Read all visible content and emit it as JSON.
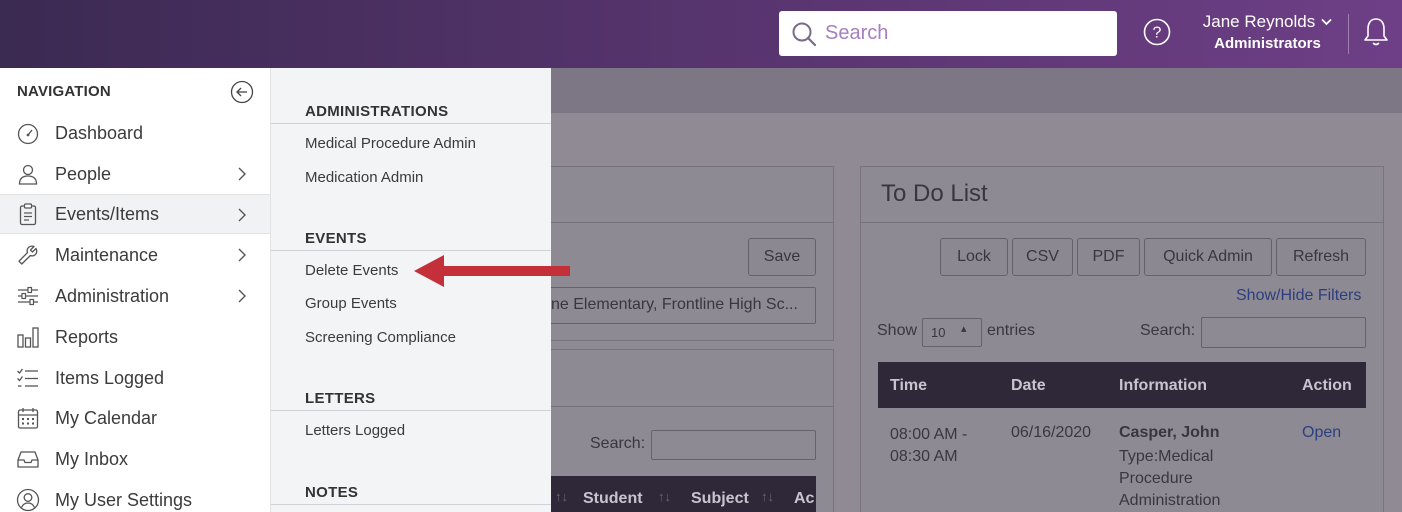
{
  "header": {
    "search_placeholder": "Search",
    "user_name": "Jane Reynolds",
    "user_role": "Administrators"
  },
  "nav": {
    "title": "NAVIGATION",
    "items": [
      {
        "label": "Dashboard",
        "icon": "dashboard-icon",
        "has_submenu": false
      },
      {
        "label": "People",
        "icon": "person-icon",
        "has_submenu": true
      },
      {
        "label": "Events/Items",
        "icon": "clipboard-icon",
        "has_submenu": true,
        "active": true
      },
      {
        "label": "Maintenance",
        "icon": "wrench-icon",
        "has_submenu": true
      },
      {
        "label": "Administration",
        "icon": "sliders-icon",
        "has_submenu": true
      },
      {
        "label": "Reports",
        "icon": "bar-chart-icon",
        "has_submenu": false
      },
      {
        "label": "Items Logged",
        "icon": "checklist-icon",
        "has_submenu": false
      },
      {
        "label": "My Calendar",
        "icon": "calendar-icon",
        "has_submenu": false
      },
      {
        "label": "My Inbox",
        "icon": "inbox-icon",
        "has_submenu": false
      },
      {
        "label": "My User Settings",
        "icon": "user-circle-icon",
        "has_submenu": false
      }
    ]
  },
  "submenu": {
    "sections": [
      {
        "heading": "ADMINISTRATIONS",
        "links": [
          "Medical Procedure Admin",
          "Medication Admin"
        ]
      },
      {
        "heading": "EVENTS",
        "links": [
          "Delete Events",
          "Group Events",
          "Screening Compliance"
        ]
      },
      {
        "heading": "LETTERS",
        "links": [
          "Letters Logged"
        ]
      },
      {
        "heading": "NOTES",
        "links": []
      }
    ]
  },
  "background": {
    "save_label": "Save",
    "schools_value": "ne Elementary, Frontline High Sc...",
    "search_label": "Search:",
    "left_table_headers": [
      "Student",
      "Subject",
      "Ac"
    ],
    "todo": {
      "title": "To Do List",
      "buttons": [
        "Lock",
        "CSV",
        "PDF",
        "Quick Admin",
        "Refresh"
      ],
      "filters_link": "Show/Hide Filters",
      "show_label": "Show",
      "entries_value": "10",
      "entries_label": "entries",
      "search_label": "Search:",
      "headers": [
        "Time",
        "Date",
        "Information",
        "Action"
      ],
      "row": {
        "time": "08:00 AM - 08:30 AM",
        "date": "06/16/2020",
        "name": "Casper, John",
        "type": "Type:Medical Procedure Administration",
        "action": "Open"
      }
    }
  },
  "colors": {
    "header_start": "#3b2a52",
    "header_end": "#6e3f86",
    "annotation_arrow": "#c4303a"
  }
}
